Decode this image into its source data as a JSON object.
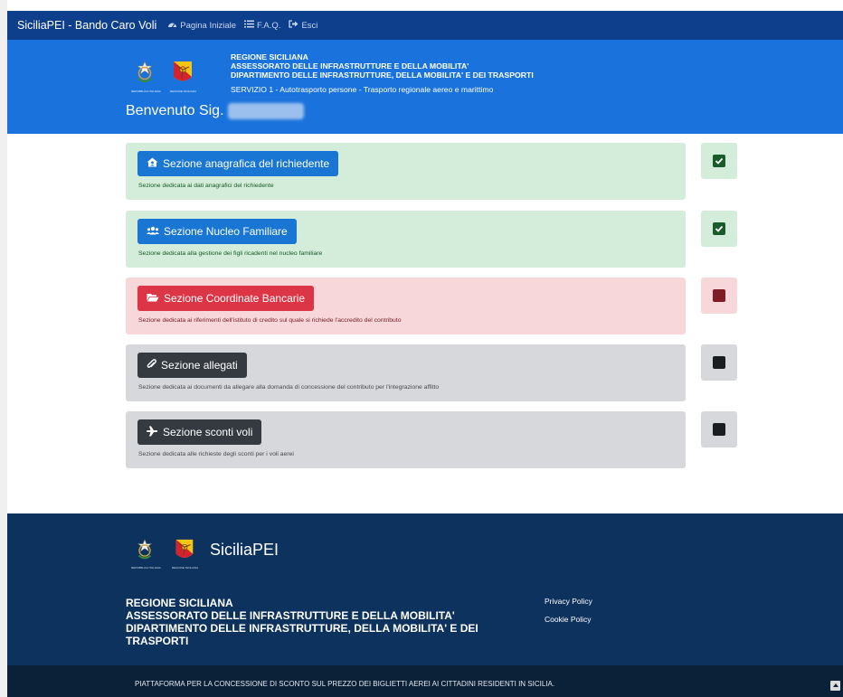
{
  "navbar": {
    "brand": "SiciliaPEI - Bando Caro Voli",
    "links": [
      {
        "label": "Pagina Iniziale",
        "icon": "dashboard-icon"
      },
      {
        "label": "F.A.Q.",
        "icon": "list-icon"
      },
      {
        "label": "Esci",
        "icon": "sign-out-icon"
      }
    ]
  },
  "header": {
    "emblem_left_caption": "REPUBBLICA ITALIANA",
    "emblem_right_caption": "REGIONE SICILIANA",
    "title_lines": [
      "REGIONE SICILIANA",
      "ASSESSORATO DELLE INFRASTRUTTURE E DELLA MOBILITA'",
      "DIPARTIMENTO DELLE INFRASTRUTTURE, DELLA MOBILITA' E DEI TRASPORTI"
    ],
    "service": "SERVIZIO 1 - Autotrasporto persone - Trasporto regionale aereo e marittimo",
    "welcome": "Benvenuto Sig."
  },
  "sections": [
    {
      "label": "Sezione anagrafica del richiedente",
      "description": "Sezione dedicata ai dati anagrafici del richiedente",
      "icon": "user-home-icon",
      "status": "complete",
      "status_color": "#1a5b2c"
    },
    {
      "label": "Sezione Nucleo Familiare",
      "description": "Sezione dedicata alla gestione dei figli ricadenti nel nucleo familiare",
      "icon": "users-icon",
      "status": "complete",
      "status_color": "#1a5b2c"
    },
    {
      "label": "Sezione Coordinate Bancarie",
      "description": "Sezione dedicata ai riferimenti dell'istituto di credito sul quale si richiede l'accredito del contributo",
      "icon": "folder-open-icon",
      "status": "incomplete",
      "status_color": "#7f1d26"
    },
    {
      "label": "Sezione allegati",
      "description": "Sezione dedicata ai documenti da allegare alla domanda di concessione del contributo per l'integrazione affitto",
      "icon": "paperclip-icon",
      "status": "empty",
      "status_color": "#1b1e21"
    },
    {
      "label": "Sezione sconti voli",
      "description": "Sezione dedicata alle richieste degli sconti per i voli aerei",
      "icon": "plane-icon",
      "status": "empty",
      "status_color": "#1b1e21"
    }
  ],
  "footer": {
    "emblem_left_caption": "REPUBBLICA ITALIANA",
    "emblem_right_caption": "REGIONE SICILIANA",
    "brand": "SiciliaPEI",
    "title_lines": [
      "REGIONE SICILIANA",
      "ASSESSORATO DELLE INFRASTRUTTURE E DELLA MOBILITA'",
      "DIPARTIMENTO DELLE INFRASTRUTTURE, DELLA MOBILITA' E DEI",
      "TRASPORTI"
    ],
    "links": [
      "Privacy Policy",
      "Cookie Policy"
    ],
    "bottom_text": "PIATTAFORMA PER LA CONCESSIONE DI SCONTO SUL PREZZO DEI BIGLIETTI AEREI AI CITTADINI RESIDENTI IN SICILIA."
  },
  "colors": {
    "navbar": "#0d3f8c",
    "header": "#1a73dc",
    "footer": "#0d325e",
    "bottom_bar": "#0b2138",
    "button_blue": "#1976d2",
    "button_red": "#dc3545",
    "button_dark": "#343a40"
  }
}
